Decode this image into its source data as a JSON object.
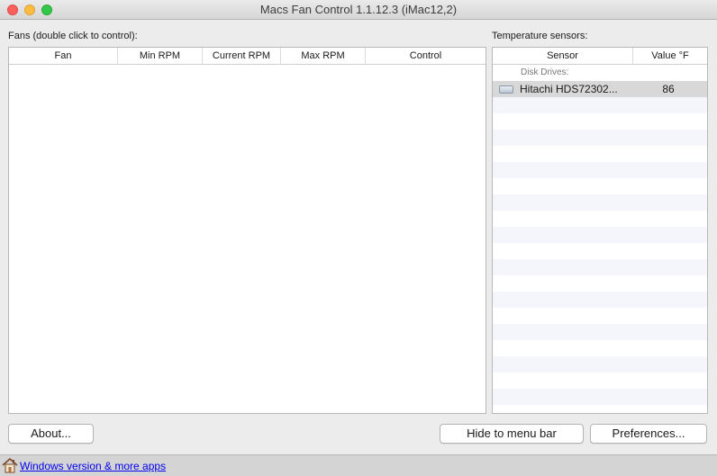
{
  "window": {
    "title": "Macs Fan Control 1.1.12.3 (iMac12,2)"
  },
  "fans": {
    "label": "Fans (double click to control):",
    "columns": [
      "Fan",
      "Min RPM",
      "Current RPM",
      "Max RPM",
      "Control"
    ]
  },
  "sensors": {
    "label": "Temperature sensors:",
    "columns": [
      "Sensor",
      "Value °F"
    ],
    "groups": [
      {
        "name": "Disk Drives:",
        "items": [
          {
            "name": "Hitachi HDS72302...",
            "value": "86",
            "icon": "hard-drive-icon"
          }
        ]
      }
    ]
  },
  "buttons": {
    "about": "About...",
    "hide": "Hide to menu bar",
    "preferences": "Preferences..."
  },
  "footer": {
    "link": "Windows version & more apps",
    "icon": "home-icon"
  },
  "colors": {
    "close": "#fc605c",
    "minimize": "#fdbc40",
    "maximize": "#34c84a",
    "link": "#0000ee",
    "selected_row": "#d8d8d8"
  }
}
